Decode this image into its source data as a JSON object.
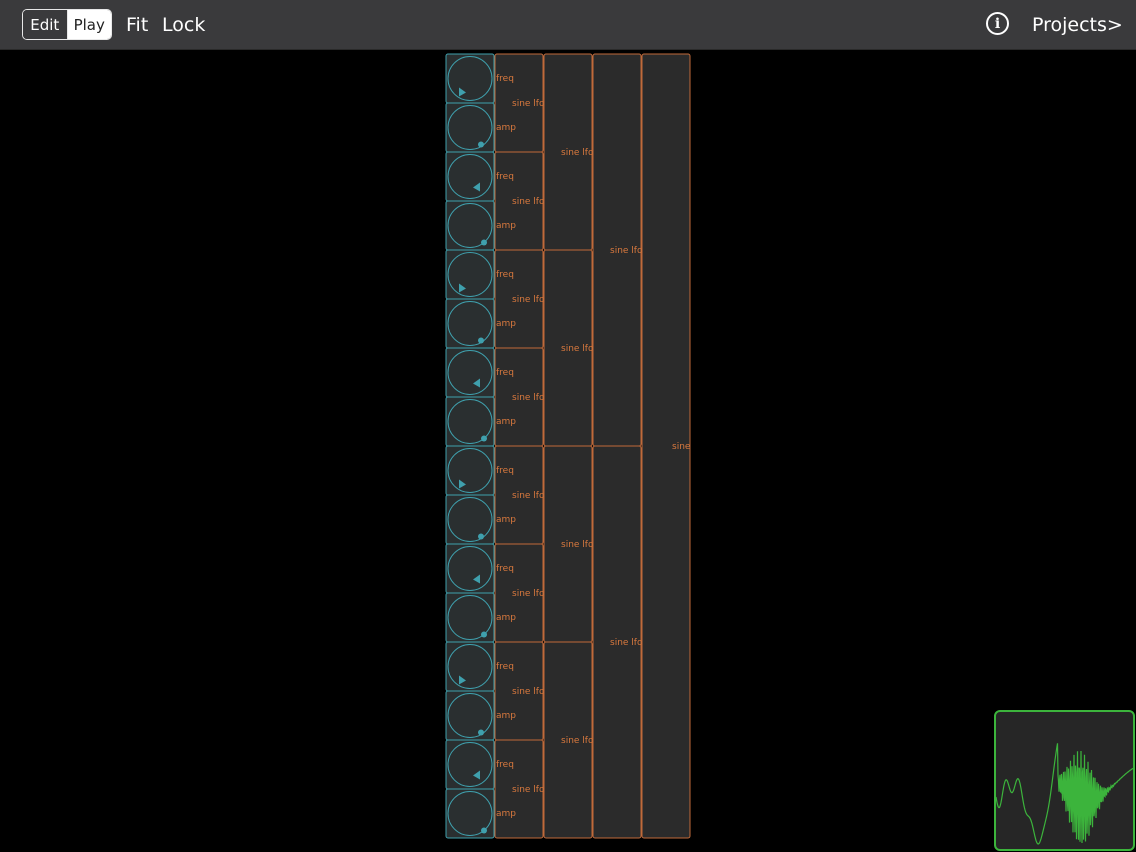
{
  "toolbar": {
    "edit_label": "Edit",
    "play_label": "Play",
    "fit_label": "Fit",
    "lock_label": "Lock",
    "info_glyph": "i",
    "projects_label": "Projects>"
  },
  "patch": {
    "knob_ports": [
      "freq",
      "amp"
    ],
    "column1": [
      "sine lfo-freq",
      "sine lfo-amp",
      "sine lfo-freq",
      "sine lfo-amp",
      "sine lfo-freq",
      "sine lfo-amp",
      "sine lfo-freq",
      "sine lfo-amp"
    ],
    "column2": [
      "sine lfo-freq",
      "sine lfo-amp",
      "sine lfo-freq",
      "sine lfo-amp"
    ],
    "column3": [
      "sine lfo-pitch",
      "sine lfo-amp"
    ],
    "column4": [
      "sine"
    ]
  },
  "colors": {
    "knob": "#3fa0ad",
    "module_border": "#c06a3a",
    "module_fill": "#2b2b2b",
    "label": "#d9793e",
    "scope": "#3cb43c"
  }
}
